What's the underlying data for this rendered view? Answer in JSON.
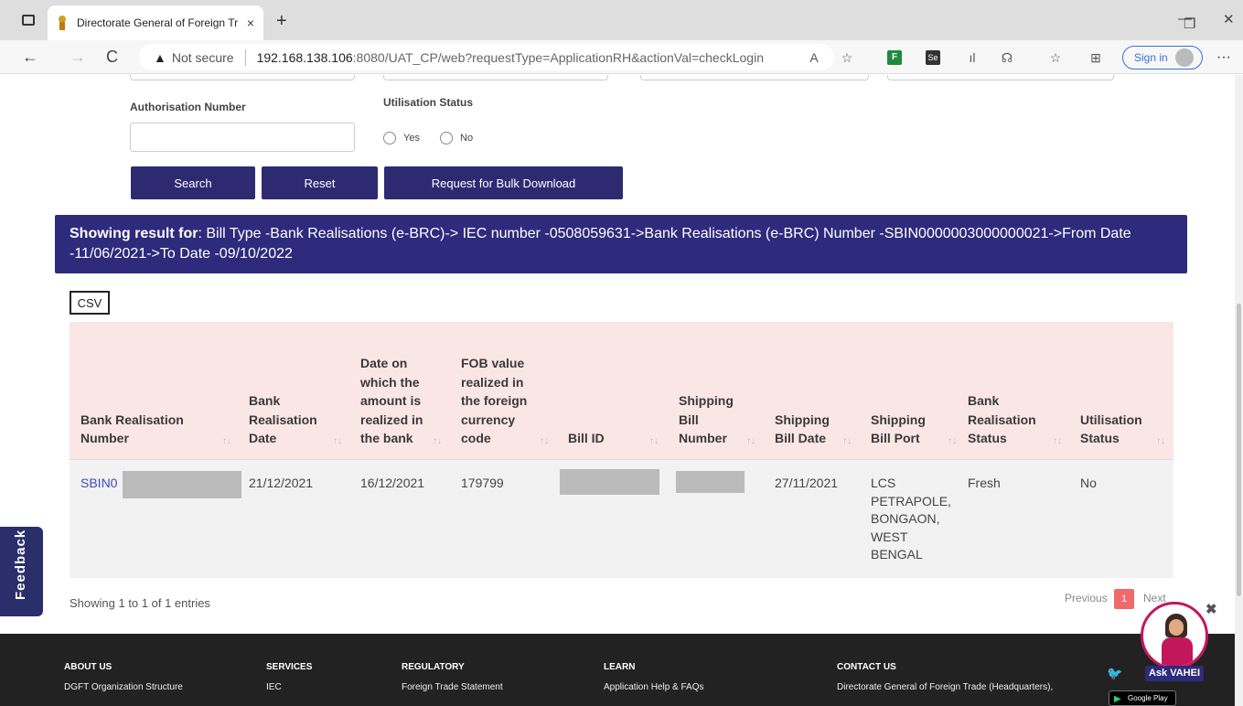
{
  "browser": {
    "tab_title": "Directorate General of Foreign Tr",
    "tab_close": "×",
    "new_tab": "+",
    "minimize": "—",
    "restore": "❐",
    "close": "✕",
    "back": "←",
    "forward": "→",
    "reload": "C",
    "warning": "▲",
    "not_secure": "Not secure",
    "url_host": "192.168.138.106",
    "url_rest": ":8080/UAT_CP/web?requestType=ApplicationRH&actionVal=checkLogin",
    "sign_in": "Sign in",
    "more": "···"
  },
  "form": {
    "auth_number_label": "Authorisation Number",
    "utilisation_label": "Utilisation Status",
    "yes_label": "Yes",
    "no_label": "No",
    "search_btn": "Search",
    "reset_btn": "Reset",
    "bulk_btn": "Request for Bulk Download"
  },
  "banner": {
    "prefix": "Showing result for",
    "text": ": Bill Type -Bank Realisations (e-BRC)-> IEC number -0508059631->Bank Realisations (e-BRC) Number -SBIN0000003000000021->From Date -11/06/2021->To Date -09/10/2022"
  },
  "csv_label": "CSV",
  "table": {
    "headers": [
      "Bank Realisation Number",
      "Bank Realisation Date",
      "Date on which the amount is realized in the bank",
      "FOB value realized in the foreign currency code",
      "Bill ID",
      "Shipping Bill Number",
      "Shipping Bill Date",
      "Shipping Bill Port",
      "Bank Realisation Status",
      "Utilisation Status"
    ],
    "sort_icon": "↑↓",
    "rows": [
      {
        "brc_number": "SBIN0",
        "brc_date": "21/12/2021",
        "realized_date": "16/12/2021",
        "fob_value": "179799",
        "bill_id": "",
        "shipping_bill_number": "",
        "shipping_bill_date": "27/11/2021",
        "shipping_bill_port": "LCS PETRAPOLE, BONGAON, WEST BENGAL",
        "status": "Fresh",
        "utilisation": "No"
      }
    ]
  },
  "pagination": {
    "info": "Showing 1 to 1 of 1 entries",
    "previous": "Previous",
    "page": "1",
    "next": "Next"
  },
  "feedback": "Feedback",
  "footer": {
    "col1_head": "ABOUT US",
    "col1_link": "DGFT Organization Structure",
    "col2_head": "SERVICES",
    "col2_link": "IEC",
    "col3_head": "REGULATORY",
    "col3_link": "Foreign Trade Statement",
    "col4_head": "LEARN",
    "col4_link": "Application Help & FAQs",
    "col5_head": "CONTACT US",
    "col5_link": "Directorate General of Foreign Trade (Headquarters),"
  },
  "chatbot": {
    "label": "Ask VAHEI",
    "close": "✖",
    "google_play": "Google Play"
  },
  "colors": {
    "primary_button": "#2e2a72",
    "banner": "#2e2a7c",
    "table_header": "#fbe6e6",
    "link": "#3b4bbd",
    "page_active": "#f06a6a"
  }
}
